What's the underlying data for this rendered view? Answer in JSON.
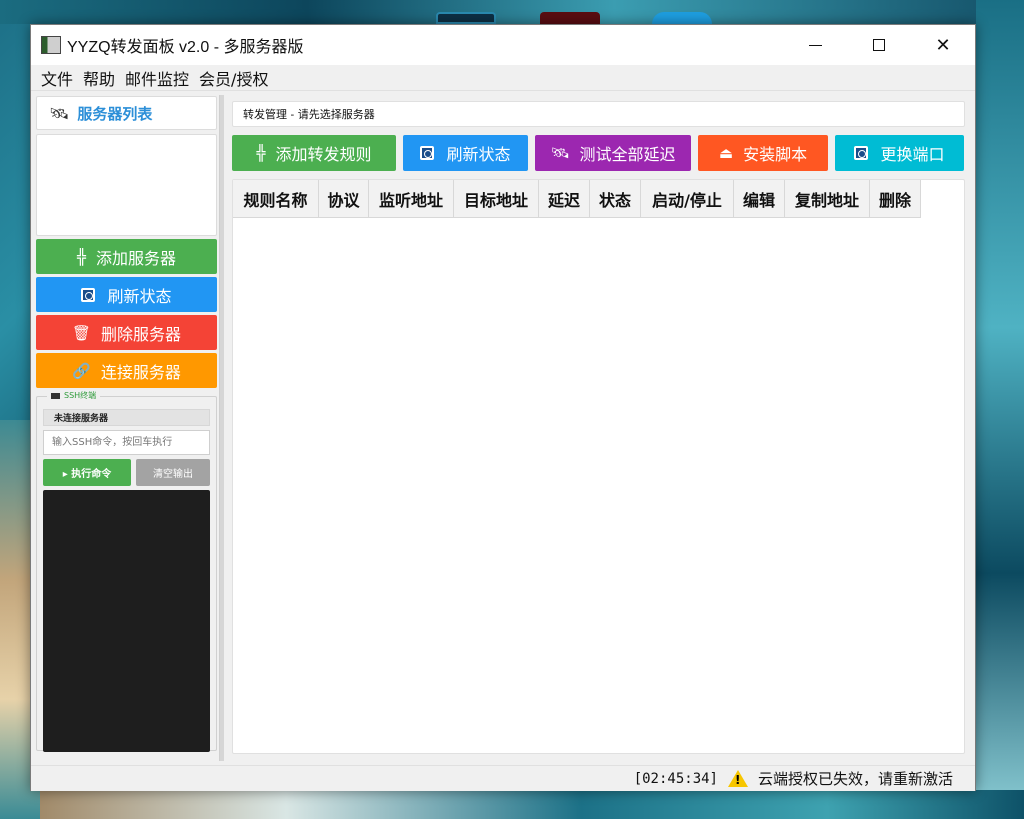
{
  "window": {
    "title": "YYZQ转发面板 v2.0 - 多服务器版",
    "controls": {
      "minimize": "minimize-icon",
      "maximize": "maximize-icon",
      "close": "✕"
    }
  },
  "menu": [
    "文件",
    "帮助",
    "邮件监控",
    "会员/授权"
  ],
  "sidebar": {
    "title": "服务器列表",
    "title_icon": "🛰",
    "buttons": [
      {
        "label": "添加服务器",
        "icon": "╬",
        "color": "#4caf50"
      },
      {
        "label": "刷新状态",
        "icon": "refresh-icon",
        "color": "#2196f3"
      },
      {
        "label": "删除服务器",
        "icon": "🗑",
        "color": "#f44336"
      },
      {
        "label": "连接服务器",
        "icon": "🔗",
        "color": "#ff9800"
      }
    ],
    "ssh": {
      "legend": "SSH终端",
      "status": "未连接服务器",
      "input_placeholder": "输入SSH命令，按回车执行",
      "run_label": "▸ 执行命令",
      "clear_label": "清空输出"
    }
  },
  "main": {
    "header": "转发管理 - 请先选择服务器",
    "toolbar": [
      {
        "label": "添加转发规则",
        "icon": "╬",
        "color": "#4caf50"
      },
      {
        "label": "刷新状态",
        "icon": "refresh-icon",
        "color": "#2196f3"
      },
      {
        "label": "测试全部延迟",
        "icon": "🛰",
        "color": "#9c27b0"
      },
      {
        "label": "安装脚本",
        "icon": "⏏",
        "color": "#ff5722"
      },
      {
        "label": "更换端口",
        "icon": "refresh-icon",
        "color": "#00bcd4"
      }
    ],
    "columns": [
      "规则名称",
      "协议",
      "监听地址",
      "目标地址",
      "延迟",
      "状态",
      "启动/停止",
      "编辑",
      "复制地址",
      "删除"
    ]
  },
  "status_bar": {
    "time": "[02:45:34]",
    "message": "云端授权已失效，请重新激活"
  }
}
